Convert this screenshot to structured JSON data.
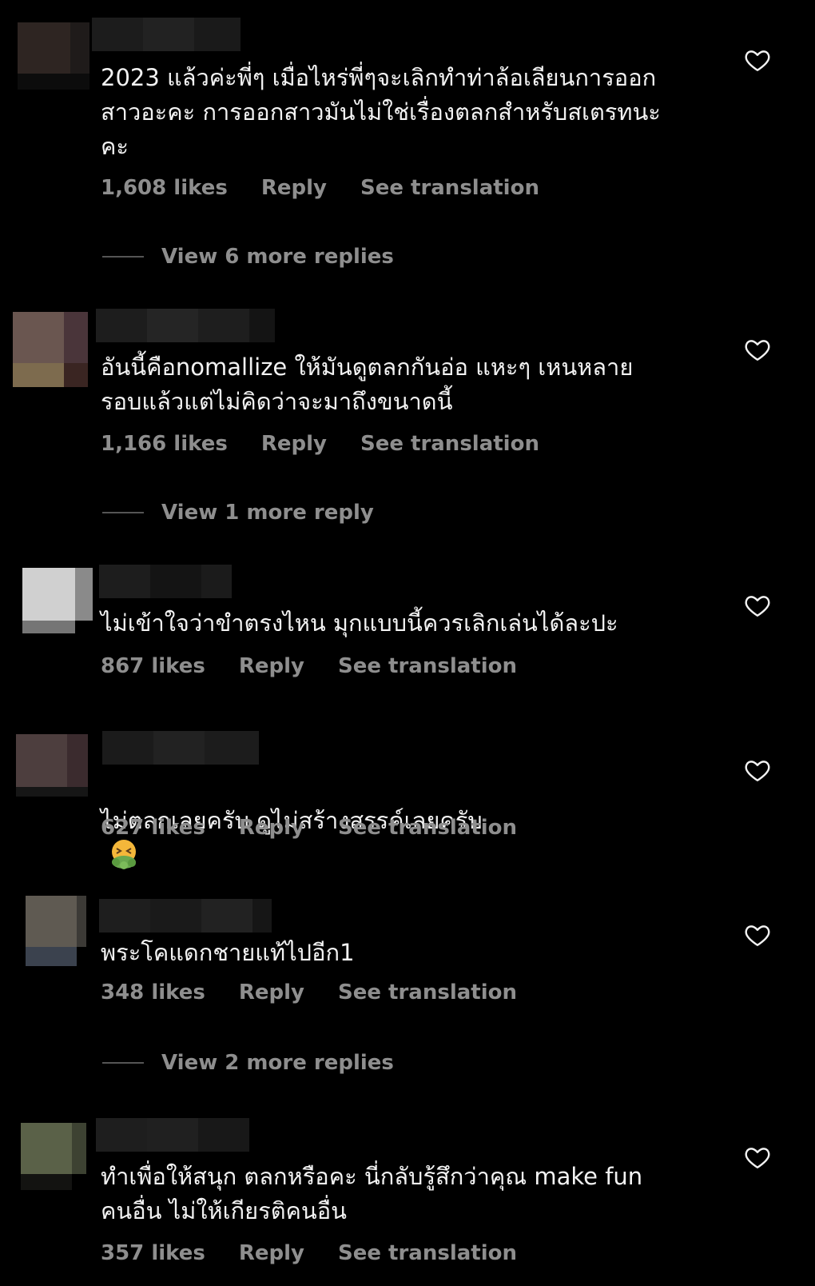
{
  "colors": {
    "background": "#000000",
    "text": "#f2f2f2",
    "meta": "#8e8e8e",
    "divider": "#555555",
    "emoji_green": "#6aa84f",
    "emoji_face": "#f4b73a"
  },
  "icons": {
    "like": "heart-outline-icon",
    "emoji": "vomiting-face-emoji"
  },
  "comments": [
    {
      "text": "2023 แล้วค่ะพี่ๆ เมื่อไหร่พี่ๆจะเลิกทำท่าล้อเลียนการออก\nสาวอะคะ การออกสาวมันไม่ใช่เรื่องตลกสำหรับสเตรทนะ\nคะ",
      "likes": "1,608 likes",
      "reply": "Reply",
      "translate": "See translation",
      "view_replies": "View 6 more replies"
    },
    {
      "text": "อันนี้คือnomallize ให้มันดูตลกกันอ่อ แหะๆ เหนหลาย\nรอบแล้วแต่ไม่คิดว่าจะมาถึงขนาดนี้",
      "likes": "1,166 likes",
      "reply": "Reply",
      "translate": "See translation",
      "view_replies": "View 1 more reply"
    },
    {
      "text": "ไม่เข้าใจว่าขำตรงไหน มุกแบบนี้ควรเลิกเล่นได้ละปะ",
      "likes": "867 likes",
      "reply": "Reply",
      "translate": "See translation"
    },
    {
      "text": "ไม่ตลกเลยครับ ดูไม่สร้างสรรค์เลยครับ",
      "likes": "627 likes",
      "reply": "Reply",
      "translate": "See translation"
    },
    {
      "text": "พระโคแดกชายแท้ไปอีก1",
      "likes": "348 likes",
      "reply": "Reply",
      "translate": "See translation",
      "view_replies": "View 2 more replies"
    },
    {
      "text": "ทำเพื่อให้สนุก ตลกหรือคะ นี่กลับรู้สึกว่าคุณ make fun\nคนอื่น ไม่ให้เกียรติคนอื่น",
      "likes": "357 likes",
      "reply": "Reply",
      "translate": "See translation"
    }
  ]
}
